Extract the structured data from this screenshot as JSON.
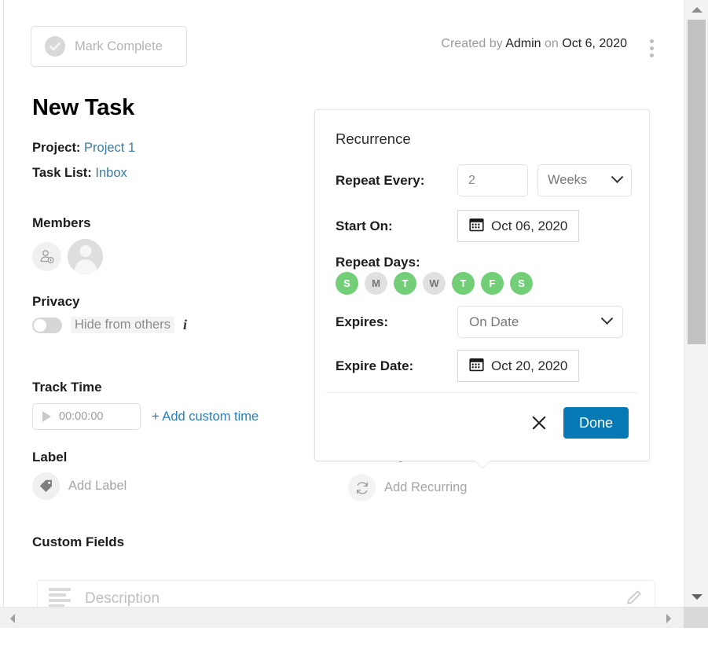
{
  "header": {
    "mark_complete_label": "Mark Complete",
    "created_prefix": "Created by",
    "created_author": "Admin",
    "created_on_word": "on",
    "created_date": "Oct 6, 2020"
  },
  "task": {
    "title": "New Task",
    "project_label": "Project:",
    "project_value": "Project 1",
    "tasklist_label": "Task List:",
    "tasklist_value": "Inbox"
  },
  "sections": {
    "members": "Members",
    "privacy": "Privacy",
    "track_time": "Track Time",
    "label": "Label",
    "custom_fields": "Custom Fields",
    "recurring": "Recurring"
  },
  "privacy": {
    "toggle_text": "Hide from others",
    "info_glyph": "i",
    "toggle_on": false
  },
  "track_time": {
    "timer_value": "00:00:00",
    "add_custom_time": "+ Add custom time"
  },
  "label": {
    "add_label": "Add Label"
  },
  "recurring": {
    "add_recurring": "Add Recurring"
  },
  "description": {
    "placeholder": "Description"
  },
  "recurrence_popup": {
    "title": "Recurrence",
    "repeat_every_label": "Repeat Every:",
    "repeat_every_value": "2",
    "repeat_unit": "Weeks",
    "start_on_label": "Start On:",
    "start_on_value": "Oct 06, 2020",
    "repeat_days_label": "Repeat Days:",
    "days": [
      {
        "letter": "S",
        "name": "sunday",
        "selected": true
      },
      {
        "letter": "M",
        "name": "monday",
        "selected": false
      },
      {
        "letter": "T",
        "name": "tuesday",
        "selected": true
      },
      {
        "letter": "W",
        "name": "wednesday",
        "selected": false
      },
      {
        "letter": "T",
        "name": "thursday",
        "selected": true
      },
      {
        "letter": "F",
        "name": "friday",
        "selected": true
      },
      {
        "letter": "S",
        "name": "saturday",
        "selected": true
      }
    ],
    "expires_label": "Expires:",
    "expires_value": "On Date",
    "expire_date_label": "Expire Date:",
    "expire_date_value": "Oct 20, 2020",
    "close_label": "×",
    "done_label": "Done"
  },
  "colors": {
    "primary_button": "#0779b5",
    "day_selected": "#72ce77",
    "day_unselected": "#e0e0e0",
    "link": "#3c7a9e",
    "action_link": "#2a7fbe"
  },
  "icons": {
    "check": "check-circle-icon",
    "kebab": "more-vertical-icon",
    "calendar": "calendar-icon",
    "chevron": "chevron-down-icon",
    "tag": "tag-icon",
    "refresh": "refresh-icon",
    "pencil": "pencil-icon",
    "play": "play-icon",
    "add_member": "add-member-icon"
  }
}
